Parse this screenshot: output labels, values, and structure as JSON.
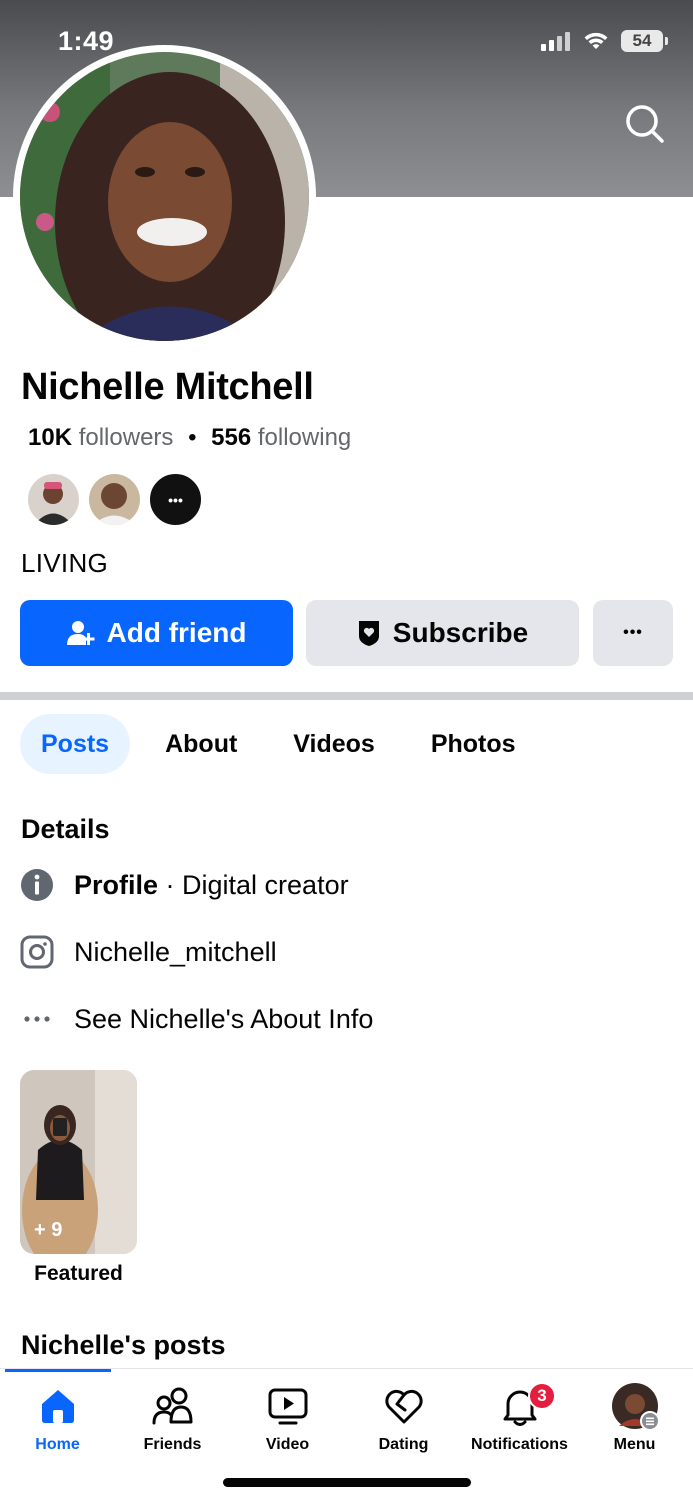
{
  "status_bar": {
    "time": "1:49",
    "battery": "54"
  },
  "profile": {
    "name": "Nichelle Mitchell",
    "followers_count": "10K",
    "followers_label": "followers",
    "separator": "•",
    "following_count": "556",
    "following_label": "following",
    "bio": "LIVING",
    "mutual_more": "•••"
  },
  "actions": {
    "add_friend": "Add friend",
    "subscribe": "Subscribe",
    "more": "•••"
  },
  "tabs": [
    {
      "label": "Posts",
      "active": true
    },
    {
      "label": "About",
      "active": false
    },
    {
      "label": "Videos",
      "active": false
    },
    {
      "label": "Photos",
      "active": false
    }
  ],
  "details": {
    "title": "Details",
    "profile_bold": "Profile",
    "profile_rest": " · Digital creator",
    "instagram": "Nichelle_mitchell",
    "about_link": "See Nichelle's About Info"
  },
  "featured": {
    "count": "+ 9",
    "label": "Featured"
  },
  "posts_title": "Nichelle's posts",
  "nav": {
    "home": "Home",
    "friends": "Friends",
    "video": "Video",
    "dating": "Dating",
    "notifications": "Notifications",
    "notifications_badge": "3",
    "menu": "Menu"
  },
  "colors": {
    "accent": "#0866ff",
    "badge": "#e41e3f",
    "secondary_button": "#e4e6eb"
  },
  "icons": [
    "chevron-left-icon",
    "search-icon",
    "add-person-icon",
    "shield-heart-icon",
    "info-icon",
    "instagram-icon",
    "more-dots-icon",
    "home-icon",
    "friends-icon",
    "video-icon",
    "dating-heart-icon",
    "bell-icon"
  ]
}
